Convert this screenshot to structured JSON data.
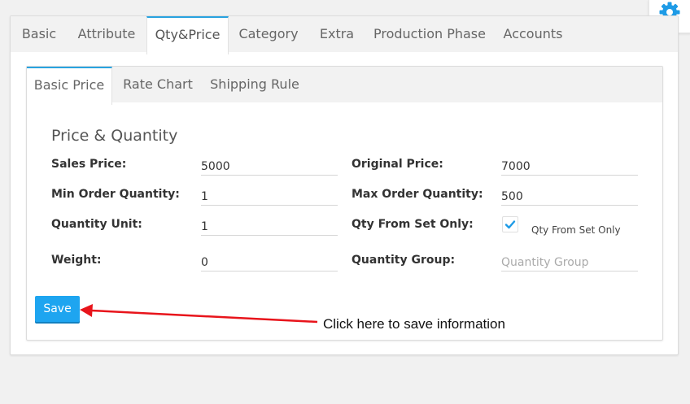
{
  "top_tabs": [
    {
      "label": "Basic"
    },
    {
      "label": "Attribute"
    },
    {
      "label": "Qty&Price",
      "active": true
    },
    {
      "label": "Category"
    },
    {
      "label": "Extra"
    },
    {
      "label": "Production Phase"
    },
    {
      "label": "Accounts"
    }
  ],
  "sub_tabs": [
    {
      "label": "Basic Price",
      "active": true
    },
    {
      "label": "Rate Chart"
    },
    {
      "label": "Shipping Rule"
    }
  ],
  "section_title": "Price & Quantity",
  "fields": {
    "sales_price": {
      "label": "Sales Price:",
      "value": "5000"
    },
    "original_price": {
      "label": "Original Price:",
      "value": "7000"
    },
    "min_order_qty": {
      "label": "Min Order Quantity:",
      "value": "1"
    },
    "max_order_qty": {
      "label": "Max Order Quantity:",
      "value": "500"
    },
    "quantity_unit": {
      "label": "Quantity Unit:",
      "value": "1"
    },
    "qty_from_set_only": {
      "label": "Qty From Set Only:",
      "checkbox_label": "Qty From Set Only",
      "checked": true
    },
    "weight": {
      "label": "Weight:",
      "value": "0"
    },
    "quantity_group": {
      "label": "Quantity Group:",
      "value": "",
      "placeholder": "Quantity Group"
    }
  },
  "save_button": {
    "label": "Save"
  },
  "annotation": {
    "text": "Click here to save information",
    "arrow_color": "#e8141b"
  },
  "colors": {
    "accent": "#1ea5f0",
    "tab_active_border": "#29a3e0",
    "gear": "#1e9be6"
  },
  "icons": {
    "settings": "gear-icon",
    "check": "check-icon"
  }
}
